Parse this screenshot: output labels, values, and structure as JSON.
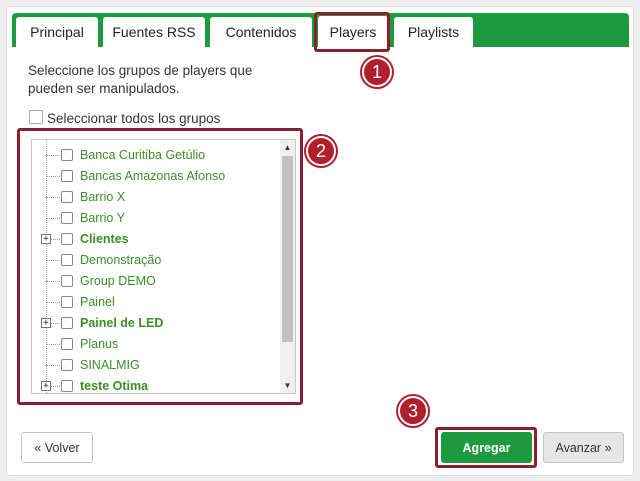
{
  "tabs": [
    {
      "label": "Principal"
    },
    {
      "label": "Fuentes RSS"
    },
    {
      "label": "Contenidos"
    },
    {
      "label": "Players"
    },
    {
      "label": "Playlists"
    }
  ],
  "active_tab": "Players",
  "instruction": "Seleccione los grupos de players que pueden ser manipulados.",
  "select_all_label": "Seleccionar todos los grupos",
  "groups": [
    {
      "label": "Banca Curitiba Getúlio",
      "bold": false,
      "expandable": false,
      "checked": false
    },
    {
      "label": "Bancas Amazonas Afonso",
      "bold": false,
      "expandable": false,
      "checked": false
    },
    {
      "label": "Barrio X",
      "bold": false,
      "expandable": false,
      "checked": false
    },
    {
      "label": "Barrio Y",
      "bold": false,
      "expandable": false,
      "checked": false
    },
    {
      "label": "Clientes",
      "bold": true,
      "expandable": true,
      "checked": false
    },
    {
      "label": "Demonstração",
      "bold": false,
      "expandable": false,
      "checked": false
    },
    {
      "label": "Group DEMO",
      "bold": false,
      "expandable": false,
      "checked": false
    },
    {
      "label": "Painel",
      "bold": false,
      "expandable": false,
      "checked": false
    },
    {
      "label": "Painel de LED",
      "bold": true,
      "expandable": true,
      "checked": false
    },
    {
      "label": "Planus",
      "bold": false,
      "expandable": false,
      "checked": false
    },
    {
      "label": "SINALMIG",
      "bold": false,
      "expandable": false,
      "checked": false
    },
    {
      "label": "teste Otima",
      "bold": true,
      "expandable": true,
      "checked": false
    }
  ],
  "expander_symbol": "+",
  "scroll_up_glyph": "▲",
  "scroll_down_glyph": "▼",
  "buttons": {
    "back": "« Volver",
    "add": "Agregar",
    "next": "Avanzar »"
  },
  "badges": [
    "1",
    "2",
    "3"
  ],
  "colors": {
    "brand_green": "#1e9a3e",
    "group_label_green": "#3b8f27",
    "highlight_border": "#8a1f2f",
    "badge_red": "#b11f2c"
  }
}
